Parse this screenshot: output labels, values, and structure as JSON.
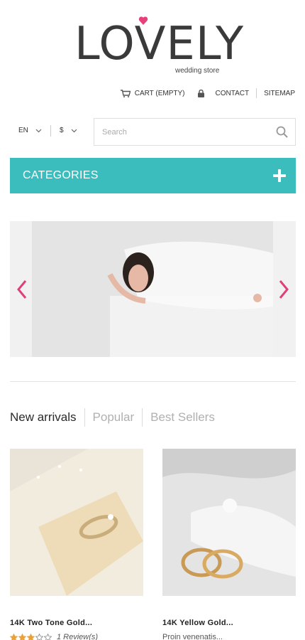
{
  "logo": {
    "title": "LOVELY",
    "subtitle": "wedding store"
  },
  "header": {
    "cart_label": "CART (EMPTY)",
    "contact_label": "CONTACT",
    "sitemap_label": "SITEMAP"
  },
  "selectors": {
    "language": "EN",
    "currency": "$"
  },
  "search": {
    "placeholder": "Search"
  },
  "categories": {
    "label": "CATEGORIES"
  },
  "tabs": [
    {
      "label": "New arrivals",
      "active": true
    },
    {
      "label": "Popular",
      "active": false
    },
    {
      "label": "Best Sellers",
      "active": false
    }
  ],
  "products": [
    {
      "name": "14K Two Tone Gold...",
      "rating": 3,
      "rating_max": 5,
      "reviews": "1 Review(s)"
    },
    {
      "name": "14K Yellow Gold...",
      "description": "Proin venenatis..."
    }
  ],
  "colors": {
    "accent": "#3bbdbd",
    "arrow": "#e0407a",
    "heart": "#e8407a",
    "star": "#e9a13a"
  }
}
